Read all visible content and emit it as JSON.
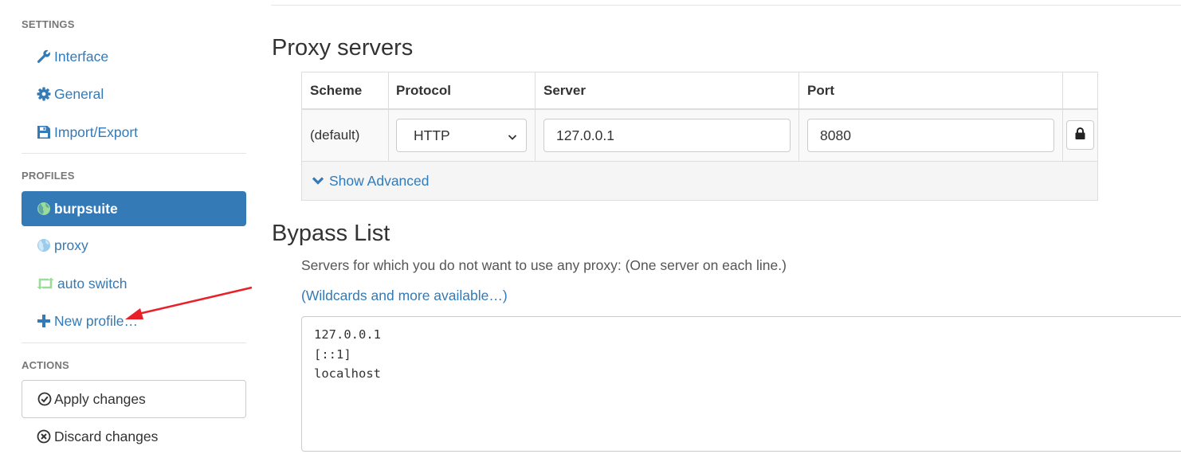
{
  "sidebar": {
    "settings_heading": "SETTINGS",
    "settings_items": [
      {
        "label": "Interface",
        "icon": "wrench-icon"
      },
      {
        "label": "General",
        "icon": "gear-icon"
      },
      {
        "label": "Import/Export",
        "icon": "floppy-disk-icon"
      }
    ],
    "profiles_heading": "PROFILES",
    "profile_items": [
      {
        "label": "burpsuite",
        "icon": "globe-icon",
        "icon_color": "#99dd99",
        "active": true
      },
      {
        "label": "proxy",
        "icon": "globe-icon",
        "icon_color": "#99ccee",
        "active": false
      },
      {
        "label": "auto switch",
        "icon": "retweet-icon",
        "icon_color": "#99dd99",
        "active": false
      }
    ],
    "new_profile_label": "New profile…",
    "actions_heading": "ACTIONS",
    "apply_label": "Apply changes",
    "discard_label": "Discard changes"
  },
  "main": {
    "proxy_title": "Proxy servers",
    "table": {
      "headers": [
        "Scheme",
        "Protocol",
        "Server",
        "Port"
      ],
      "default_row": {
        "scheme": "(default)",
        "protocol": "HTTP",
        "server": "127.0.0.1",
        "port": "8080"
      },
      "show_advanced": "Show Advanced"
    },
    "bypass_title": "Bypass List",
    "bypass_desc": "Servers for which you do not want to use any proxy: (One server on each line.)",
    "wildcards_link": "(Wildcards and more available…)",
    "bypass_lines": [
      "127.0.0.1",
      "[::1]",
      "localhost"
    ]
  },
  "colors": {
    "accent": "#337ab7",
    "annotation_arrow": "#e8202a"
  }
}
